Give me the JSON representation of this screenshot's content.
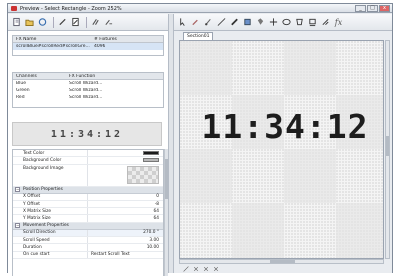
{
  "window": {
    "title": "Preview - Select Rectangle - Zoom 252%",
    "minimize_label": "_",
    "maximize_label": "□",
    "close_label": "x"
  },
  "left_toolbar": {
    "icons": [
      "new-icon",
      "open-icon",
      "undo-icon",
      "pen-icon",
      "document-icon",
      "wand-icon",
      "wand-small-icon"
    ]
  },
  "right_toolbar": {
    "icons": [
      "arrow-icon",
      "pencil-icon",
      "brush-icon",
      "line-icon",
      "marker-icon",
      "eraser-icon",
      "fill-icon",
      "move-icon",
      "ellipse-icon",
      "polygon-icon",
      "stamp-icon",
      "text-icon",
      "fx-icon"
    ]
  },
  "fixtures_table": {
    "headers": [
      "FX Name",
      "# Fixtures"
    ],
    "rows": [
      {
        "name": "scrollBlue#scrollRed#scrollGre...",
        "count": "4096"
      }
    ]
  },
  "channels_table": {
    "headers": [
      "Channels",
      "FX Function"
    ],
    "rows": [
      {
        "channel": "Blue",
        "function": "Scroll Wizard..."
      },
      {
        "channel": "Green",
        "function": "Scroll Wizard..."
      },
      {
        "channel": "Red",
        "function": "Scroll Wizard..."
      }
    ]
  },
  "preview_strip": {
    "text": "11:34:12"
  },
  "properties": {
    "appearance": [
      {
        "name": "Text Color",
        "swatch": "#1a1a1a"
      },
      {
        "name": "Background Color",
        "swatch": "#b9b9b9"
      },
      {
        "name": "Background Image"
      }
    ],
    "position_category": "Position Properties",
    "position": [
      {
        "name": "X Offset",
        "value": "0"
      },
      {
        "name": "Y Offset",
        "value": "-8"
      },
      {
        "name": "X Matrix Size",
        "value": "64"
      },
      {
        "name": "Y Matrix Size",
        "value": "64"
      }
    ],
    "movement_category": "Movement Properties",
    "movement": [
      {
        "name": "Scroll Direction",
        "value": "270.0 °"
      },
      {
        "name": "Scroll Speed",
        "value": "3.00"
      },
      {
        "name": "Duration",
        "value": "10.00"
      },
      {
        "name": "On cue start",
        "value": "Restart Scroll Text"
      }
    ]
  },
  "canvas": {
    "tab_label": "Section01",
    "clock_text": "11:34:12",
    "text_color": "#1d1d1d",
    "grid_color": "#d4d4d4"
  },
  "bottom_toolbar": {
    "icons": [
      "ruler-icon",
      "select-icon",
      "zoom-icon",
      "pan-icon"
    ]
  }
}
